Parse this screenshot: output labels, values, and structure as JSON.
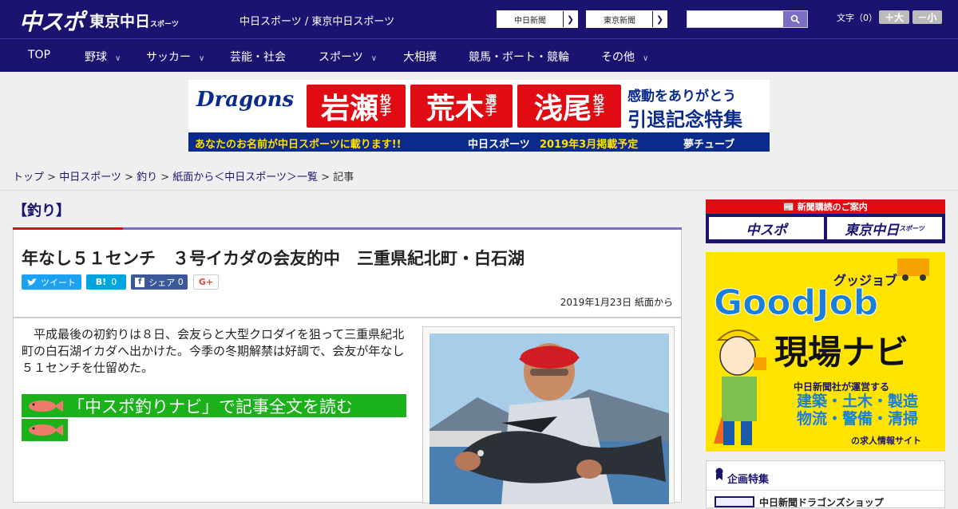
{
  "header": {
    "logo_main": "中スポ",
    "logo_tokyo": "東京中日",
    "logo_tokyo_small": "スポーツ",
    "site_title": "中日スポーツ / 東京中日スポーツ",
    "link1": "中日新聞",
    "link2": "東京新聞",
    "font_size_label": "文字（0）",
    "font_plus": "＋大",
    "font_minus": "－小"
  },
  "nav": {
    "items": [
      {
        "label": "TOP"
      },
      {
        "label": "野球"
      },
      {
        "label": "サッカー"
      },
      {
        "label": "芸能・社会"
      },
      {
        "label": "スポーツ"
      },
      {
        "label": "大相撲"
      },
      {
        "label": "競馬・ボート・競輪"
      },
      {
        "label": "その他"
      }
    ]
  },
  "banner_ad": {
    "team": "Dragons",
    "player1": "岩瀬",
    "player2": "荒木",
    "player3": "浅尾",
    "role1": "投手",
    "role2": "選手",
    "role3": "投手",
    "line1": "感動をありがとう",
    "line2": "引退記念特集",
    "bottom_left": "あなたのお名前が中日スポーツに載ります!!",
    "bottom_logo": "中日スポーツ",
    "bottom_date": "2019年3月掲載予定",
    "bottom_right": "夢チューブ"
  },
  "breadcrumb": {
    "items": [
      "トップ",
      "中日スポーツ",
      "釣り",
      "紙面から＜中日スポーツ＞一覧"
    ],
    "current": "記事"
  },
  "category": "【釣り】",
  "article": {
    "title": "年なし５１センチ　３号イカダの会友的中　三重県紀北町・白石湖",
    "share": {
      "tweet": "ツイート",
      "hatena_count": "0",
      "fb_label": "シェア",
      "fb_count": "0",
      "gplus": "G+"
    },
    "date": "2019年1月23日 紙面から",
    "body": "平成最後の初釣りは８日、会友らと大型クロダイを狙って三重県紀北町の白石湖イカダへ出かけた。今季の冬期解禁は好調で、会友が年なし５１センチを仕留めた。",
    "read_more": "「中スポ釣りナビ」で記事全文を読む"
  },
  "sidebar": {
    "subscribe_header": "新聞購読のご案内",
    "sub_chuspo": "中スポ",
    "sub_tokyo": "東京中日",
    "sub_tokyo_small": "スポーツ",
    "goodjob_kana": "グッジョブ",
    "goodjob": "GoodJob",
    "goodjob_navi": "現場ナビ",
    "goodjob_desc": "中日新聞社が運営する",
    "goodjob_jobs1": "建築・土木・製造",
    "goodjob_jobs2": "物流・警備・清掃",
    "goodjob_site": "の求人情報サイト",
    "special_header": "企画特集",
    "special_item": "中日新聞ドラゴンズショップ"
  },
  "colors": {
    "brand": "#1a1470",
    "accent_red": "#e10b14",
    "read_more_green": "#1bb11b"
  }
}
